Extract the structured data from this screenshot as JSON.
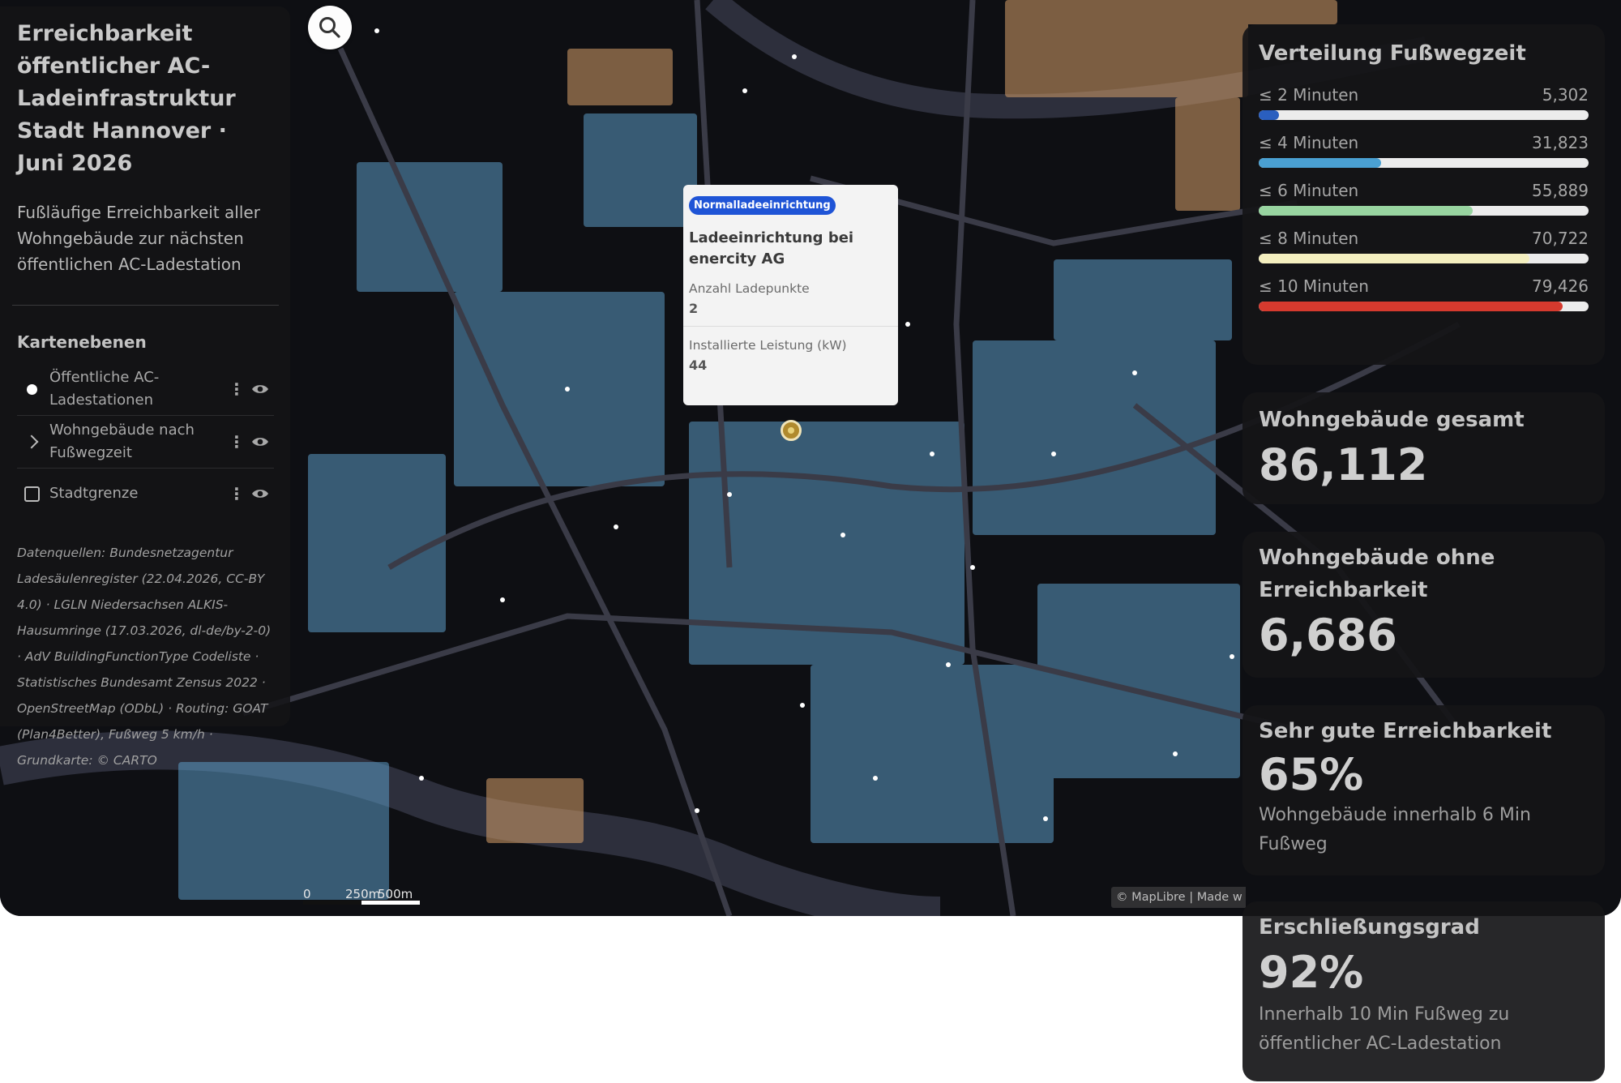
{
  "panel": {
    "title": "Erreichbarkeit öffentlicher AC-Ladeinfrastruktur Stadt Hannover · Juni 2026",
    "subtitle": "Fußläufige Erreichbarkeit aller Wohngebäude zur nächsten öffentlichen AC-Ladestation",
    "layers_heading": "Kartenebenen",
    "layers": [
      {
        "label": "Öffentliche AC-Ladestationen",
        "control": "dot"
      },
      {
        "label": "Wohngebäude nach Fußwegzeit",
        "control": "chevron"
      },
      {
        "label": "Stadtgrenze",
        "control": "checkbox"
      }
    ],
    "sources": "Datenquellen: Bundesnetzagentur Ladesäulenregister (22.04.2026, CC-BY 4.0) · LGLN Niedersachsen ALKIS-Hausumringe (17.03.2026, dl-de/by-2-0) · AdV BuildingFunctionType Codeliste · Statistisches Bundesamt Zensus 2022 · OpenStreetMap (ODbL) · Routing: GOAT (Plan4Better), Fußweg 5 km/h · Grundkarte: © CARTO"
  },
  "popup": {
    "badge": "Normalladeeinrichtung",
    "title": "Ladeeinrichtung bei enercity AG",
    "fields": [
      {
        "label": "Anzahl Ladepunkte",
        "value": "2"
      },
      {
        "label": "Installierte Leistung (kW)",
        "value": "44"
      }
    ]
  },
  "scale": {
    "zero": "0",
    "mid": "250m",
    "end": "500m"
  },
  "attribution": "© MapLibre | Made w",
  "distribution": {
    "title": "Verteilung Fußwegzeit",
    "max": 86112,
    "rows": [
      {
        "label": "≤ 2 Minuten",
        "count": "5,302",
        "value": 5302,
        "color": "#2a5fbf"
      },
      {
        "label": "≤ 4 Minuten",
        "count": "31,823",
        "value": 31823,
        "color": "#4aa0d2"
      },
      {
        "label": "≤ 6 Minuten",
        "count": "55,889",
        "value": 55889,
        "color": "#98d4a0"
      },
      {
        "label": "≤ 8 Minuten",
        "count": "70,722",
        "value": 70722,
        "color": "#f4efbf"
      },
      {
        "label": "≤ 10 Minuten",
        "count": "79,426",
        "value": 79426,
        "color": "#d63a2e"
      }
    ]
  },
  "kpis": {
    "total": {
      "title": "Wohngebäude gesamt",
      "value": "86,112"
    },
    "unreached": {
      "title": "Wohngebäude ohne Erreichbarkeit",
      "value": "6,686"
    },
    "very_good": {
      "title": "Sehr gute Erreichbarkeit",
      "value": "65%",
      "desc": "Wohngebäude innerhalb 6 Min Fußweg"
    },
    "coverage": {
      "title": "Erschließungsgrad",
      "value": "92%",
      "desc": "Innerhalb 10 Min Fußweg zu öffentlicher AC-Ladestation"
    }
  },
  "colors": {
    "map_bg": "#0e0f13",
    "road": "#3a3b47",
    "river": "#2d2f3c",
    "building_blue": "#5b9ac4",
    "building_warm": "#d7a06a",
    "accent_badge": "#1f54d6"
  }
}
